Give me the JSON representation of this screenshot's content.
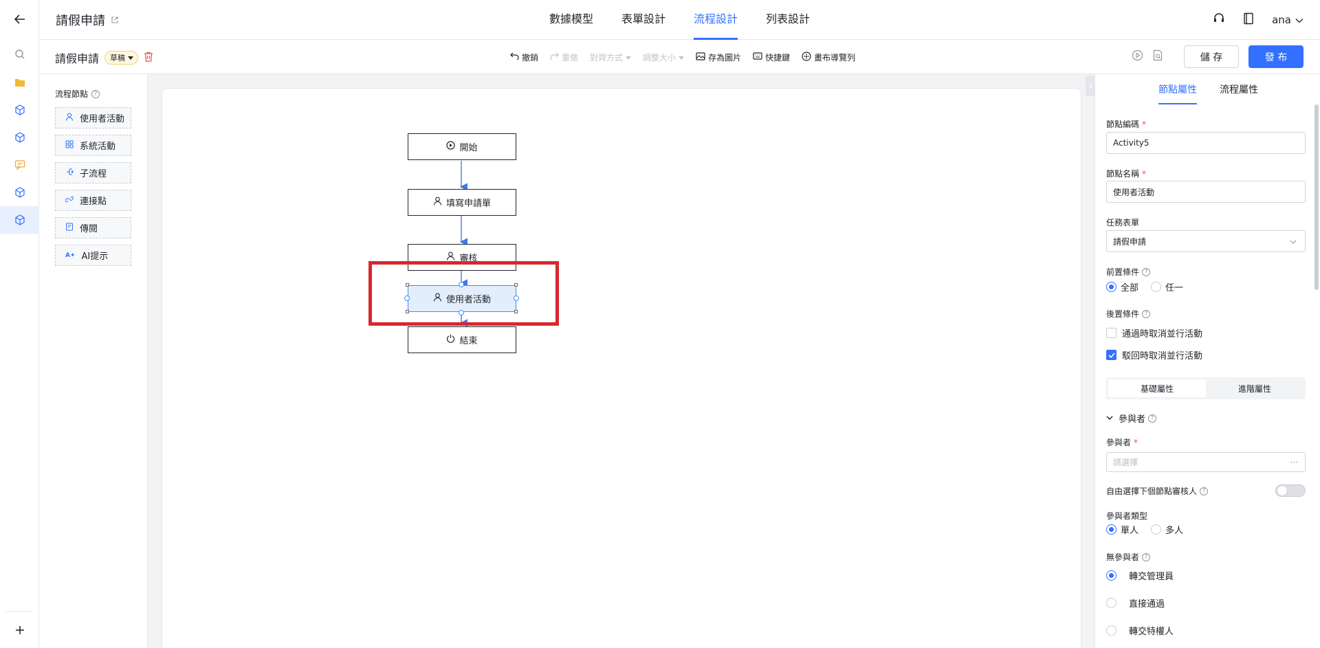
{
  "app": {
    "title": "請假申請"
  },
  "nav": {
    "tabs": [
      {
        "label": "數據模型"
      },
      {
        "label": "表單設計"
      },
      {
        "label": "流程設計"
      },
      {
        "label": "列表設計"
      }
    ],
    "user": "ana"
  },
  "toolbar": {
    "process_name": "請假申請",
    "status_badge": "草稿",
    "undo": "撤銷",
    "redo": "重做",
    "align": "對齊方式",
    "resize": "調整大小",
    "save_image": "存為圖片",
    "shortcuts": "快捷鍵",
    "canvas_nav": "畫布導覽列",
    "save": "儲 存",
    "publish": "發 布"
  },
  "palette": {
    "title": "流程節點",
    "items": [
      {
        "label": "使用者活動"
      },
      {
        "label": "系統活動"
      },
      {
        "label": "子流程"
      },
      {
        "label": "連接點"
      },
      {
        "label": "傳閱"
      },
      {
        "label": "AI提示"
      }
    ]
  },
  "flow": {
    "nodes": [
      {
        "label": "開始"
      },
      {
        "label": "填寫申請單"
      },
      {
        "label": "審核"
      },
      {
        "label": "使用者活動"
      },
      {
        "label": "結束"
      }
    ]
  },
  "panel": {
    "tabs": [
      {
        "label": "節點屬性"
      },
      {
        "label": "流程屬性"
      }
    ],
    "node_code_label": "節點編碼",
    "node_code_value": "Activity5",
    "node_name_label": "節點名稱",
    "node_name_value": "使用者活動",
    "task_form_label": "任務表單",
    "task_form_value": "請假申請",
    "pre_condition_label": "前置條件",
    "pre_options": [
      "全部",
      "任一"
    ],
    "post_condition_label": "後置條件",
    "post_options": [
      "通過時取消並行活動",
      "駁回時取消並行活動"
    ],
    "seg": [
      "基礎屬性",
      "進階屬性"
    ],
    "participants_section": "參與者",
    "participants_label": "參與者",
    "participants_placeholder": "請選擇",
    "free_select_label": "自由選擇下個節點審核人",
    "participant_type_label": "參與者類型",
    "participant_type_options": [
      "單人",
      "多人"
    ],
    "no_participant_label": "無參與者",
    "no_participant_options": [
      "轉交管理員",
      "直接通過",
      "轉交特權人"
    ]
  }
}
